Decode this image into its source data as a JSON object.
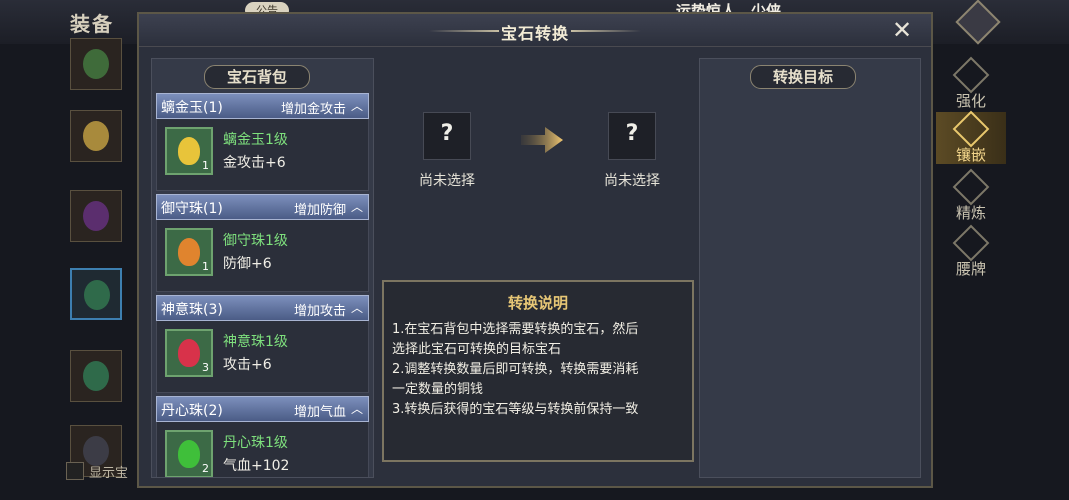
{
  "background": {
    "screen_title": "装备",
    "notice_badge": "公告",
    "scroll_text": "运势惊人，少侠",
    "show_label": "显示宝",
    "side_tabs": [
      {
        "label": "强化",
        "active": false
      },
      {
        "label": "镶嵌",
        "active": true
      },
      {
        "label": "精炼",
        "active": false
      },
      {
        "label": "腰牌",
        "active": false
      }
    ]
  },
  "modal": {
    "title": "宝石转换",
    "close_icon": "close-icon"
  },
  "gem_bag": {
    "title": "宝石背包",
    "groups": [
      {
        "name": "螭金玉(1)",
        "effect": "增加金攻击",
        "item": {
          "name": "螭金玉1级",
          "stat": "金攻击+6",
          "count": "1",
          "color": "#e8c43a"
        }
      },
      {
        "name": "御守珠(1)",
        "effect": "增加防御",
        "item": {
          "name": "御守珠1级",
          "stat": "防御+6",
          "count": "1",
          "color": "#e0842e"
        }
      },
      {
        "name": "神意珠(3)",
        "effect": "增加攻击",
        "item": {
          "name": "神意珠1级",
          "stat": "攻击+6",
          "count": "3",
          "color": "#d8324a"
        }
      },
      {
        "name": "丹心珠(2)",
        "effect": "增加气血",
        "item": {
          "name": "丹心珠1级",
          "stat": "气血+102",
          "count": "2",
          "color": "#3fbf3a"
        }
      }
    ]
  },
  "conversion": {
    "source_slot": "?",
    "source_label": "尚未选择",
    "target_slot": "?",
    "target_label": "尚未选择",
    "arrow_icon": "arrow-right-icon"
  },
  "target_panel": {
    "title": "转换目标"
  },
  "description": {
    "title": "转换说明",
    "lines": [
      "1.在宝石背包中选择需要转换的宝石，然后",
      "选择此宝石可转换的目标宝石",
      "2.调整转换数量后即可转换，转换需要消耗",
      "一定数量的铜钱",
      "3.转换后获得的宝石等级与转换前保持一致"
    ]
  },
  "colors": {
    "accent_gold": "#e7c776",
    "gem_name_green": "#7ee07d",
    "group_header_blue": "#6477a6"
  }
}
